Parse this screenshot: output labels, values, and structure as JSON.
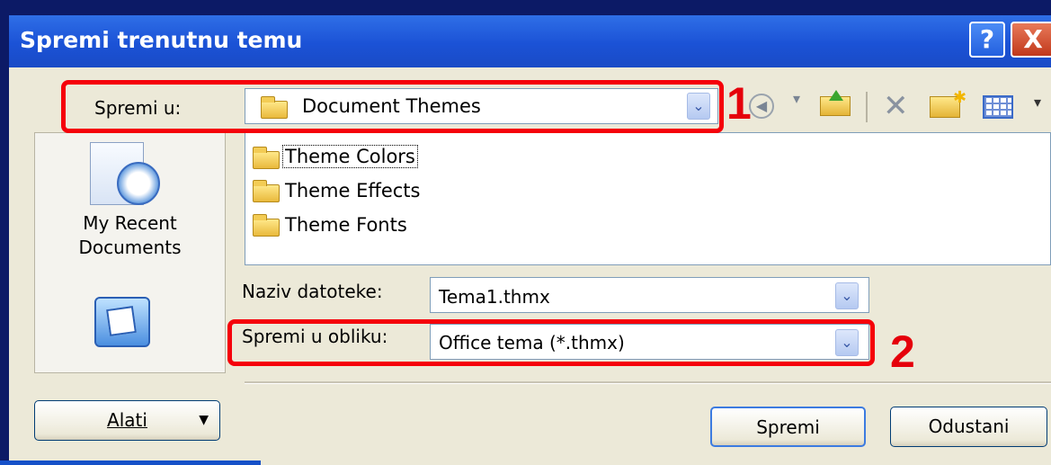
{
  "window": {
    "title": "Spremi trenutnu temu",
    "help_button": "?",
    "close_button": "X"
  },
  "save_in": {
    "label": "Spremi u:",
    "value": "Document Themes"
  },
  "toolbar": {
    "icons": [
      "back-icon",
      "up-folder-icon",
      "delete-icon",
      "new-folder-icon",
      "views-icon"
    ]
  },
  "places_bar": {
    "recent_line1": "My Recent",
    "recent_line2": "Documents"
  },
  "file_list": {
    "items": [
      "Theme Colors",
      "Theme Effects",
      "Theme Fonts"
    ]
  },
  "file_name": {
    "label": "Naziv datoteke:",
    "value": "Tema1.thmx"
  },
  "save_as_type": {
    "label": "Spremi u obliku:",
    "value": "Office tema (*.thmx)"
  },
  "buttons": {
    "tools": "Alati",
    "save": "Spremi",
    "cancel": "Odustani"
  },
  "annotations": {
    "marker1": "1",
    "marker2": "2",
    "highlight_color": "#f5000a"
  }
}
